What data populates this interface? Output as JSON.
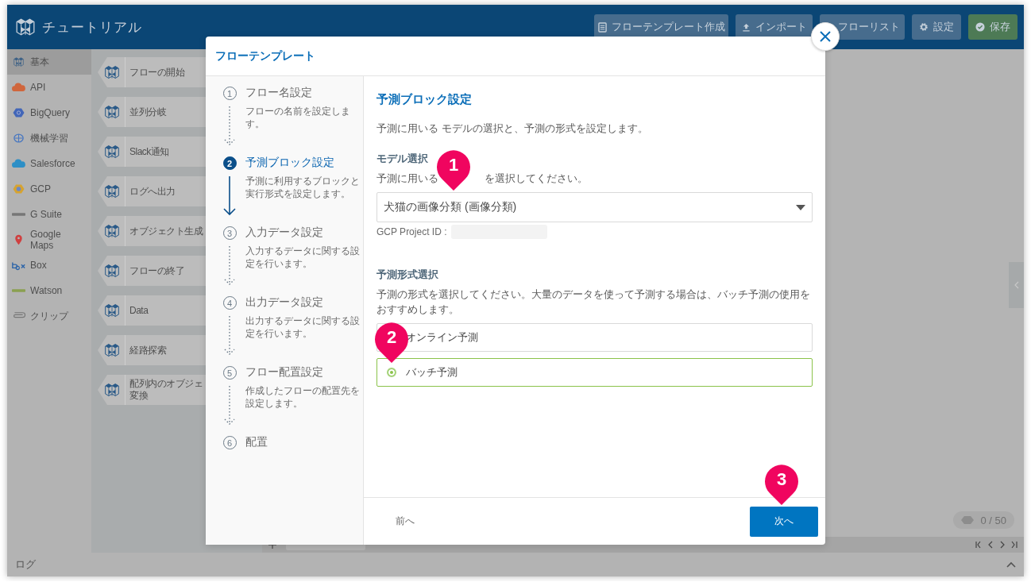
{
  "app": {
    "title": "チュートリアル"
  },
  "header_buttons": [
    {
      "kind": "template",
      "label": "フローテンプレート作成"
    },
    {
      "kind": "import",
      "label": "インポート"
    },
    {
      "kind": "list",
      "label": "フローリスト"
    },
    {
      "kind": "settings",
      "label": "設定"
    },
    {
      "kind": "save",
      "label": "保存"
    }
  ],
  "sidebar": {
    "items": [
      {
        "label": "基本",
        "selected": true
      },
      {
        "label": "API",
        "selected": false
      },
      {
        "label": "BigQuery",
        "selected": false
      },
      {
        "label": "機械学習",
        "selected": false
      },
      {
        "label": "Salesforce",
        "selected": false
      },
      {
        "label": "GCP",
        "selected": false
      },
      {
        "label": "G Suite",
        "selected": false
      },
      {
        "label": "Google Maps",
        "selected": false
      },
      {
        "label": "Box",
        "selected": false
      },
      {
        "label": "Watson",
        "selected": false
      },
      {
        "label": "クリップ",
        "selected": false
      }
    ]
  },
  "blocks": [
    {
      "label": "フローの開始"
    },
    {
      "label": "並列分岐"
    },
    {
      "label": "Slack通知"
    },
    {
      "label": "ログへ出力"
    },
    {
      "label": "オブジェクト生成"
    },
    {
      "label": "フローの終了"
    },
    {
      "label": "Data"
    },
    {
      "label": "経路探索"
    },
    {
      "label": "配列内のオブジェ変換"
    }
  ],
  "canvas": {
    "counter": "0 / 50"
  },
  "log_bar": {
    "label": "ログ"
  },
  "modal": {
    "title": "フローテンプレート",
    "steps": [
      {
        "number": "1",
        "title": "フロー名設定",
        "description": "フローの名前を設定します。",
        "active": false
      },
      {
        "number": "2",
        "title": "予測ブロック設定",
        "description": "予測に利用するブロックと実行形式を設定します。",
        "active": true
      },
      {
        "number": "3",
        "title": "入力データ設定",
        "description": "入力するデータに関する設定を行います。",
        "active": false
      },
      {
        "number": "4",
        "title": "出力データ設定",
        "description": "出力するデータに関する設定を行います。",
        "active": false
      },
      {
        "number": "5",
        "title": "フロー配置設定",
        "description": "作成したフローの配置先を設定します。",
        "active": false
      },
      {
        "number": "6",
        "title": "配置",
        "active": false
      }
    ],
    "heading": "予測ブロック設定",
    "intro": "予測に用いる モデルの選択と、予測の形式を設定します。",
    "model_section": {
      "heading": "モデル選択",
      "help_before": "予測に用いる",
      "help_after": "を選択してください。",
      "select_value": "犬猫の画像分類 (画像分類)",
      "project_label": "GCP Project ID :"
    },
    "format_section": {
      "heading": "予測形式選択",
      "help": "予測の形式を選択してください。大量のデータを使って予測する場合は、バッチ予測の使用をおすすめします。",
      "options": [
        {
          "label": "オンライン予測",
          "selected": false
        },
        {
          "label": "バッチ予測",
          "selected": true
        }
      ]
    },
    "back_button": "前へ",
    "next_button": "次へ"
  },
  "callouts": [
    "1",
    "2",
    "3"
  ]
}
